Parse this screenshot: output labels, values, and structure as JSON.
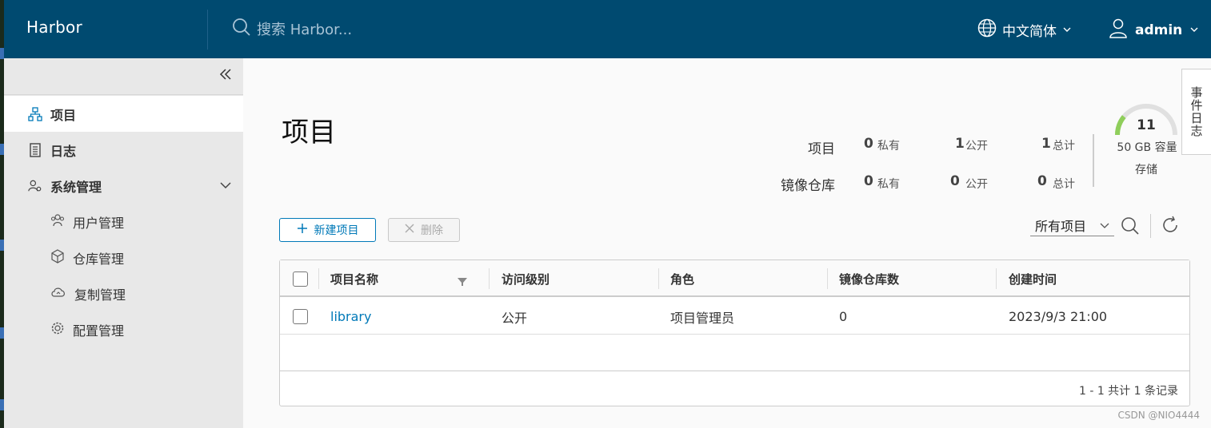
{
  "header": {
    "brand": "Harbor",
    "search_placeholder": "搜索 Harbor...",
    "language": "中文简体",
    "user": "admin"
  },
  "sidebar": {
    "items": [
      {
        "label": "项目",
        "icon": "project-icon",
        "active": true
      },
      {
        "label": "日志",
        "icon": "log-icon"
      },
      {
        "label": "系统管理",
        "icon": "admin-icon",
        "expanded": true
      }
    ],
    "sub_items": [
      {
        "label": "用户管理",
        "icon": "users-icon"
      },
      {
        "label": "仓库管理",
        "icon": "box-icon"
      },
      {
        "label": "复制管理",
        "icon": "cloud-icon"
      },
      {
        "label": "配置管理",
        "icon": "gear-icon"
      }
    ]
  },
  "main": {
    "title": "项目",
    "stats": {
      "projects_label": "项目",
      "repos_label": "镜像仓库",
      "private_label": "私有",
      "public_label": "公开",
      "total_label": "总计",
      "projects": {
        "private": "0",
        "public": "1",
        "total": "1"
      },
      "repos": {
        "private": "0",
        "public": "0",
        "total": "0"
      }
    },
    "storage": {
      "value": "11",
      "capacity": "50 GB 容量",
      "label": "存储",
      "used_fraction": 0.22,
      "track_color": "#e0e0e0",
      "fill_color": "#8fce5b"
    },
    "event_log": "事件日志",
    "toolbar": {
      "new_project": "新建项目",
      "delete": "删除",
      "filter": "所有项目"
    },
    "table": {
      "columns": [
        "项目名称",
        "访问级别",
        "角色",
        "镜像仓库数",
        "创建时间"
      ],
      "rows": [
        {
          "name": "library",
          "access": "公开",
          "role": "项目管理员",
          "repo_count": "0",
          "created": "2023/9/3 21:00"
        }
      ],
      "footer": "1 - 1 共计 1 条记录"
    }
  },
  "watermark": "CSDN @NIO4444",
  "colors": {
    "header": "#004a70",
    "accent": "#0079b8"
  }
}
